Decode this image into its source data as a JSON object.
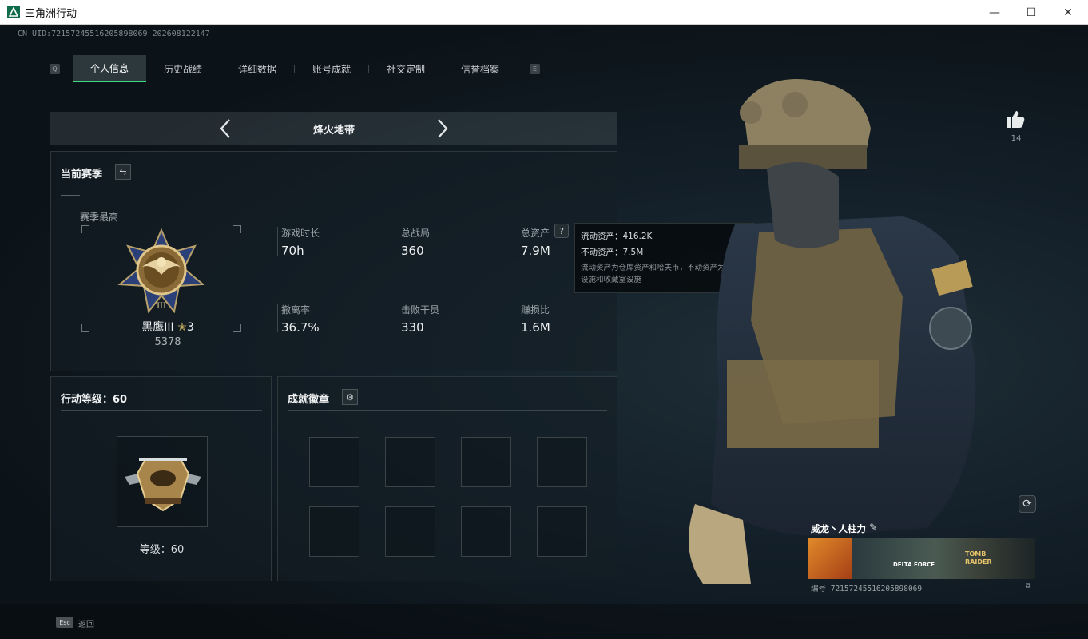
{
  "window": {
    "title": "三角洲行动",
    "minimize": "—",
    "maximize": "☐",
    "close": "✕"
  },
  "uid_top": "CN UID:7215724551620589806​9 2026081221​47",
  "nav": {
    "key_left": "Q",
    "key_right": "E",
    "tabs": [
      {
        "label": "个人信息",
        "active": true
      },
      {
        "label": "历史战绩"
      },
      {
        "label": "详细数据"
      },
      {
        "label": "账号成就"
      },
      {
        "label": "社交定制"
      },
      {
        "label": "信誉档案"
      }
    ]
  },
  "mode": {
    "title": "烽火地带",
    "prev": "‹",
    "next": "›"
  },
  "season": {
    "title": "当前赛季",
    "best_label": "赛季最高",
    "rank_name": "黑鹰III",
    "rank_star_count": "3",
    "rank_score": "5378",
    "stats": [
      {
        "label": "游戏时长",
        "value": "70h"
      },
      {
        "label": "总战局",
        "value": "360"
      },
      {
        "label": "总资产",
        "value": "7.9M"
      },
      {
        "label": "撤离率",
        "value": "36.7%"
      },
      {
        "label": "击败干员",
        "value": "330"
      },
      {
        "label": "赚损比",
        "value": "1.6M"
      }
    ],
    "help_icon": "?"
  },
  "tooltip": {
    "liquid": "流动资产：416.2K",
    "fixed": "不动资产：7.5M",
    "note": "流动资产为仓库资产和哈夫币，不动资产为特勤处设施和收藏室设施"
  },
  "level": {
    "title": "行动等级：60",
    "label": "等级：60"
  },
  "achievements": {
    "title": "成就徽章"
  },
  "likes": {
    "count": "14"
  },
  "card": {
    "name": "威龙丶人柱力",
    "uid": "编号 72157245516205898069",
    "banner_text_1": "DELTA FORCE",
    "banner_text_2": "TOMB RAIDER"
  },
  "footer": {
    "esc_key": "Esc",
    "back_label": "返回"
  },
  "colors": {
    "accent": "#3ddc84",
    "bg": "#0d1418",
    "panel_border": "#2c363b"
  }
}
